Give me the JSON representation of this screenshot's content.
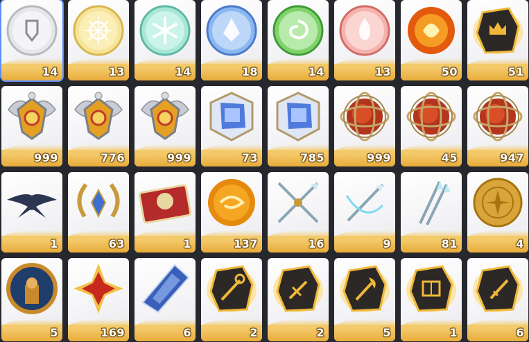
{
  "inventory": {
    "items": [
      {
        "icon": "silver-emblem-icon",
        "count": "14"
      },
      {
        "icon": "gold-sun-emblem-icon",
        "count": "13"
      },
      {
        "icon": "cyan-snowflake-emblem-icon",
        "count": "14"
      },
      {
        "icon": "blue-crystal-emblem-icon",
        "count": "18"
      },
      {
        "icon": "green-swirl-emblem-icon",
        "count": "14"
      },
      {
        "icon": "red-flame-emblem-icon",
        "count": "13"
      },
      {
        "icon": "fire-orb-icon",
        "count": "50"
      },
      {
        "icon": "dark-crown-stone-icon",
        "count": "51"
      },
      {
        "icon": "winged-amber-crest-icon",
        "count": "999"
      },
      {
        "icon": "winged-amber-crest-icon",
        "count": "776"
      },
      {
        "icon": "winged-amber-crest-icon",
        "count": "999"
      },
      {
        "icon": "blue-crystal-cube-icon",
        "count": "73"
      },
      {
        "icon": "blue-crystal-cube-icon",
        "count": "785"
      },
      {
        "icon": "armillary-fire-sphere-icon",
        "count": "999"
      },
      {
        "icon": "armillary-fire-sphere-icon",
        "count": "45"
      },
      {
        "icon": "armillary-fire-sphere-icon",
        "count": "947"
      },
      {
        "icon": "manta-ray-icon",
        "count": "1"
      },
      {
        "icon": "laurel-gem-wreath-icon",
        "count": "63"
      },
      {
        "icon": "red-ticket-icon",
        "count": "1"
      },
      {
        "icon": "amber-orb-icon",
        "count": "137"
      },
      {
        "icon": "crossed-spears-icon",
        "count": "16"
      },
      {
        "icon": "spear-bow-icon",
        "count": "9"
      },
      {
        "icon": "twin-spears-icon",
        "count": "81"
      },
      {
        "icon": "gold-seal-icon",
        "count": "4"
      },
      {
        "icon": "knight-medallion-icon",
        "count": "5"
      },
      {
        "icon": "red-star-gem-icon",
        "count": "169"
      },
      {
        "icon": "blue-shard-crystal-icon",
        "count": "6"
      },
      {
        "icon": "dark-stone-staff-icon",
        "count": "2"
      },
      {
        "icon": "dark-stone-sword-icon",
        "count": "2"
      },
      {
        "icon": "dark-stone-axe-icon",
        "count": "5"
      },
      {
        "icon": "dark-stone-book-icon",
        "count": "1"
      },
      {
        "icon": "dark-stone-dagger-icon",
        "count": "6"
      }
    ],
    "selected_index": 0
  }
}
